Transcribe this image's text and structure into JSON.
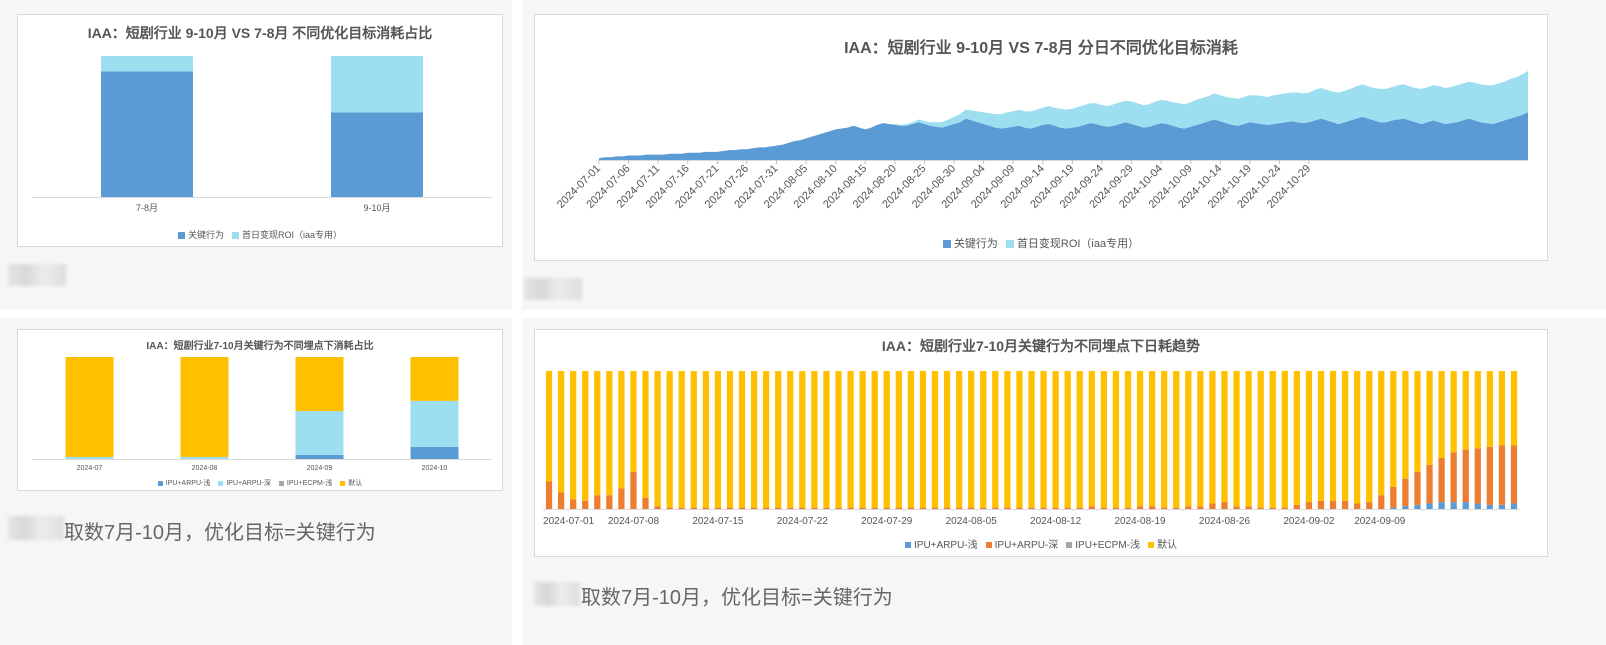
{
  "colors": {
    "key_action": "#5b9bd5",
    "first_day_roi": "#9ddff0",
    "ipu_arpu_shallow": "#5b9bd5",
    "ipu_arpu_deep": "#ed7d31",
    "ipu_ecpm_shallow": "#a5a5a5",
    "default": "#ffc000"
  },
  "captions": {
    "left": "取数7月-10月，优化目标=关键行为",
    "right": "取数7月-10月，优化目标=关键行为"
  },
  "chart_data": [
    {
      "id": "chart1",
      "type": "bar",
      "stacked": true,
      "title": "IAA：短剧行业 9-10月 VS 7-8月 不同优化目标消耗占比",
      "categories": [
        "7-8月",
        "9-10月"
      ],
      "series": [
        {
          "name": "关键行为",
          "values": [
            89,
            60
          ],
          "color": "#5b9bd5"
        },
        {
          "name": "首日变现ROI（iaa专用）",
          "values": [
            11,
            40
          ],
          "color": "#9ddff0"
        }
      ],
      "ylim": [
        0,
        100
      ],
      "legend": "bottom"
    },
    {
      "id": "chart2",
      "type": "area",
      "stacked": true,
      "title": "IAA：短剧行业 9-10月 VS 7-8月 分日不同优化目标消耗",
      "x_start": "2024-07-01",
      "x_ticks": [
        "2024-07-01",
        "2024-07-06",
        "2024-07-11",
        "2024-07-16",
        "2024-07-21",
        "2024-07-26",
        "2024-07-31",
        "2024-08-05",
        "2024-08-10",
        "2024-08-15",
        "2024-08-20",
        "2024-08-25",
        "2024-08-30",
        "2024-09-04",
        "2024-09-09",
        "2024-09-14",
        "2024-09-19",
        "2024-09-24",
        "2024-09-29",
        "2024-10-04",
        "2024-10-09",
        "2024-10-14",
        "2024-10-19",
        "2024-10-24",
        "2024-10-29"
      ],
      "series": [
        {
          "name": "关键行为",
          "color": "#5b9bd5",
          "values": [
            2,
            3,
            3,
            4,
            4,
            5,
            5,
            5,
            6,
            6,
            6,
            6,
            7,
            7,
            7,
            8,
            8,
            8,
            9,
            9,
            9,
            10,
            11,
            11,
            12,
            12,
            13,
            14,
            14,
            15,
            16,
            17,
            19,
            21,
            22,
            24,
            26,
            28,
            30,
            32,
            34,
            35,
            36,
            38,
            36,
            34,
            36,
            39,
            41,
            40,
            39,
            38,
            38,
            40,
            42,
            40,
            38,
            37,
            36,
            38,
            40,
            42,
            46,
            44,
            42,
            40,
            38,
            36,
            35,
            36,
            37,
            38,
            36,
            35,
            37,
            39,
            40,
            38,
            36,
            35,
            36,
            37,
            39,
            41,
            40,
            38,
            37,
            38,
            40,
            42,
            40,
            38,
            36,
            37,
            39,
            41,
            40,
            38,
            36,
            35,
            37,
            39,
            41,
            43,
            45,
            43,
            41,
            39,
            38,
            40,
            42,
            41,
            40,
            39,
            40,
            41,
            42,
            43,
            42,
            41,
            42,
            44,
            46,
            44,
            42,
            40,
            42,
            44,
            46,
            48,
            46,
            44,
            42,
            42,
            44,
            45,
            46,
            44,
            42,
            40,
            42,
            44,
            42,
            40,
            41,
            42,
            44,
            46,
            44,
            42,
            41,
            40,
            42,
            44,
            46,
            48,
            50,
            53
          ]
        },
        {
          "name": "首日变现ROI（iaa专用）",
          "color": "#9ddff0",
          "values": [
            0,
            0,
            0,
            0,
            0,
            0,
            0,
            0,
            0,
            0,
            0,
            0,
            0,
            0,
            0,
            0,
            0,
            0,
            0,
            0,
            0,
            0,
            0,
            0,
            0,
            0,
            0,
            0,
            0,
            0,
            0,
            0,
            0,
            0,
            0,
            0,
            0,
            0,
            0,
            0,
            0,
            0,
            0,
            0,
            0,
            0,
            0,
            0,
            0,
            0,
            1,
            1,
            2,
            2,
            3,
            3,
            4,
            5,
            6,
            7,
            8,
            9,
            10,
            11,
            12,
            13,
            14,
            15,
            16,
            17,
            17,
            18,
            18,
            19,
            19,
            19,
            20,
            20,
            21,
            21,
            21,
            22,
            22,
            22,
            23,
            23,
            23,
            24,
            24,
            24,
            25,
            25,
            25,
            25,
            26,
            26,
            26,
            26,
            27,
            27,
            27,
            28,
            28,
            28,
            29,
            29,
            29,
            30,
            30,
            30,
            30,
            31,
            31,
            31,
            32,
            32,
            32,
            32,
            33,
            33,
            33,
            34,
            34,
            34,
            34,
            35,
            35,
            35,
            36,
            36,
            36,
            36,
            37,
            37,
            37,
            38,
            38,
            38,
            38,
            39,
            39,
            39,
            40,
            40,
            40,
            41,
            41,
            41,
            42,
            42,
            42,
            43,
            43,
            43,
            44,
            44,
            45,
            46,
            48,
            78
          ]
        }
      ],
      "legend": "bottom"
    },
    {
      "id": "chart3",
      "type": "bar",
      "stacked": true,
      "title": "IAA：短剧行业7-10月关键行为不同埋点下消耗占比",
      "categories": [
        "2024-07",
        "2024-08",
        "2024-09",
        "2024-10"
      ],
      "series": [
        {
          "name": "IPU+ARPU-浅",
          "values": [
            0,
            0,
            4,
            12
          ],
          "color": "#5b9bd5"
        },
        {
          "name": "IPU+ARPU-深",
          "values": [
            2,
            2,
            43,
            45
          ],
          "color": "#9ddff0"
        },
        {
          "name": "IPU+ECPM-浅",
          "values": [
            0,
            0,
            0,
            0
          ],
          "color": "#a5a5a5"
        },
        {
          "name": "默认",
          "values": [
            98,
            98,
            53,
            43
          ],
          "color": "#ffc000"
        }
      ],
      "ylim": [
        0,
        100
      ],
      "legend": "bottom"
    },
    {
      "id": "chart4",
      "type": "bar",
      "stacked": true,
      "title": "IAA：短剧行业7-10月关键行为不同埋点下日耗趋势",
      "x_start": "2024-07-01",
      "x_ticks": [
        "2024-07-01",
        "2024-07-08",
        "2024-07-15",
        "2024-07-22",
        "2024-07-29",
        "2024-08-05",
        "2024-08-12",
        "2024-08-19",
        "2024-08-26",
        "2024-09-02",
        "2024-09-09"
      ],
      "series": [
        {
          "name": "IPU+ARPU-浅",
          "color": "#5b9bd5",
          "values": [
            0,
            0,
            0,
            0,
            0,
            0,
            0,
            0,
            0,
            0,
            0,
            0,
            0,
            0,
            0,
            0,
            0,
            0,
            0,
            0,
            0,
            0,
            0,
            0,
            0,
            0,
            0,
            0,
            0,
            0,
            0,
            0,
            0,
            0,
            0,
            0,
            0,
            0,
            0,
            0,
            0,
            0,
            0,
            0,
            0,
            0,
            0,
            0,
            0,
            0,
            0,
            0,
            0,
            0,
            0,
            0,
            0,
            0,
            0,
            0,
            0,
            0,
            0,
            0,
            0,
            0,
            0,
            0,
            0,
            0,
            1,
            2,
            3,
            4,
            5,
            5,
            5,
            4,
            3,
            3,
            4
          ]
        },
        {
          "name": "IPU+ARPU-深",
          "color": "#ed7d31",
          "values": [
            20,
            12,
            7,
            6,
            10,
            10,
            15,
            27,
            8,
            2,
            1,
            1,
            1,
            1,
            1,
            1,
            1,
            1,
            1,
            1,
            1,
            1,
            1,
            1,
            1,
            1,
            1,
            1,
            1,
            1,
            1,
            1,
            1,
            1,
            1,
            1,
            1,
            1,
            1,
            1,
            1,
            1,
            1,
            1,
            1,
            2,
            1,
            1,
            1,
            2,
            2,
            1,
            1,
            2,
            2,
            4,
            5,
            2,
            2,
            1,
            1,
            1,
            3,
            5,
            6,
            6,
            6,
            4,
            5,
            10,
            15,
            20,
            24,
            28,
            32,
            36,
            38,
            40,
            42,
            43,
            42
          ]
        },
        {
          "name": "IPU+ECPM-浅",
          "color": "#a5a5a5",
          "values": [
            0,
            0,
            0,
            0,
            0,
            0,
            0,
            0,
            0,
            0,
            0,
            0,
            0,
            0,
            0,
            0,
            0,
            0,
            0,
            0,
            0,
            0,
            0,
            0,
            0,
            0,
            0,
            0,
            0,
            0,
            0,
            0,
            0,
            0,
            0,
            0,
            0,
            0,
            0,
            0,
            0,
            0,
            0,
            0,
            0,
            0,
            0,
            0,
            0,
            0,
            0,
            0,
            0,
            0,
            0,
            0,
            0,
            0,
            0,
            0,
            0,
            0,
            0,
            0,
            0,
            0,
            0,
            0,
            0,
            0,
            0,
            0,
            0,
            0,
            0,
            0,
            0,
            0,
            0,
            0,
            0
          ]
        },
        {
          "name": "默认",
          "color": "#ffc000",
          "values": [
            80,
            88,
            93,
            94,
            90,
            90,
            85,
            73,
            92,
            98,
            99,
            99,
            99,
            99,
            99,
            99,
            99,
            99,
            99,
            99,
            99,
            99,
            99,
            99,
            99,
            99,
            99,
            99,
            99,
            99,
            99,
            99,
            99,
            99,
            99,
            99,
            99,
            99,
            99,
            99,
            99,
            99,
            99,
            99,
            99,
            98,
            99,
            99,
            99,
            98,
            98,
            99,
            99,
            98,
            98,
            96,
            95,
            98,
            98,
            99,
            99,
            99,
            97,
            95,
            94,
            94,
            94,
            96,
            95,
            90,
            84,
            78,
            73,
            68,
            63,
            59,
            57,
            56,
            55,
            54,
            54
          ]
        }
      ],
      "ylim": [
        0,
        100
      ],
      "legend": "bottom"
    }
  ]
}
